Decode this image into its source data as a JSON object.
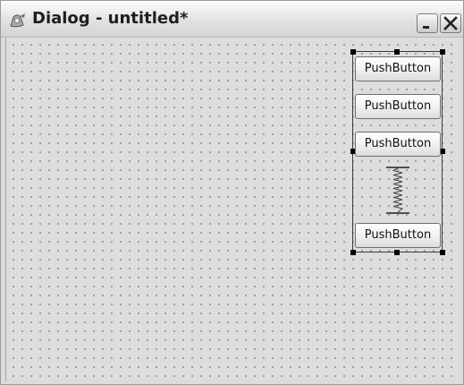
{
  "window": {
    "title": "Dialog - untitled*",
    "icon": "designer-icon",
    "controls": [
      "minimize-icon",
      "close-icon"
    ]
  },
  "form": {
    "grid": "dotted",
    "layout": "vertical",
    "buttons": [
      {
        "label": "PushButton"
      },
      {
        "label": "PushButton"
      },
      {
        "label": "PushButton"
      },
      {
        "label": "PushButton"
      }
    ],
    "spacer": {
      "orientation": "vertical",
      "icon": "vertical-spacer-icon"
    }
  }
}
